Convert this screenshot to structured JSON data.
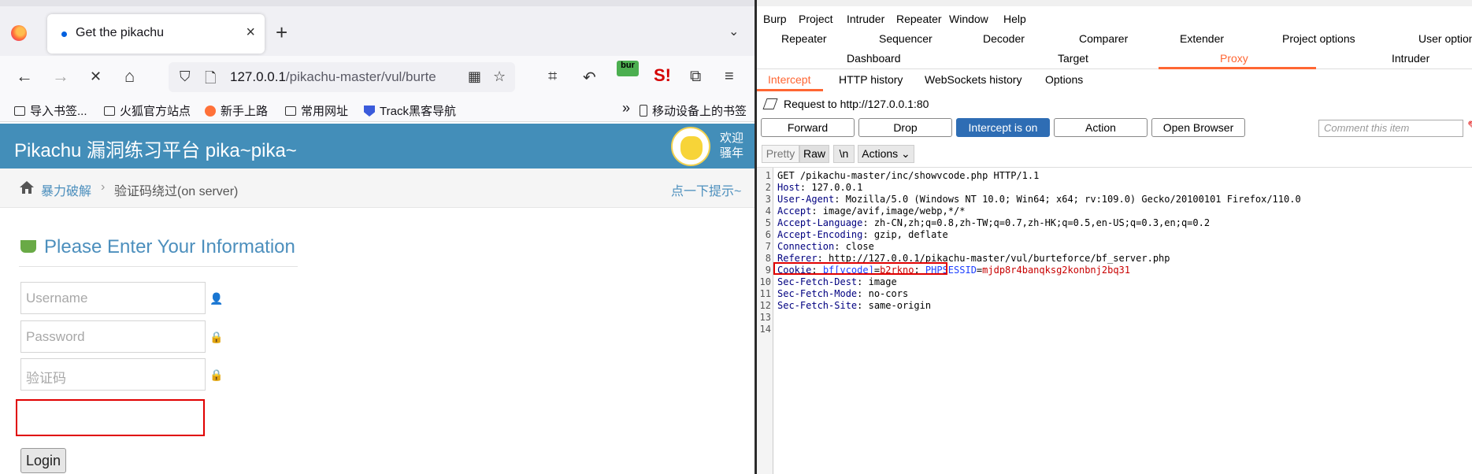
{
  "firefox": {
    "tab": {
      "title": "Get the pikachu",
      "close": "×"
    },
    "newtab": "+",
    "tabs_menu": "⌄",
    "nav": {
      "back": "←",
      "forward": "→",
      "stop": "✕",
      "home": "⌂"
    },
    "url": {
      "host": "127.0.0.1",
      "path": "/pikachu-master/vul/burte"
    },
    "urlbar_icons": {
      "shield": "⛉",
      "page": "🗋",
      "qr": "▦",
      "star": "☆"
    },
    "ext": {
      "crop": "⌗",
      "undo": "↶",
      "bur": "bur",
      "s": "S!",
      "puzzle": "⧉",
      "menu": "≡"
    },
    "bookmarks": [
      "导入书签...",
      "火狐官方站点",
      "新手上路",
      "常用网址",
      "Track黑客导航"
    ],
    "bookmarks_overflow": "»",
    "mobile_bookmarks": "移动设备上的书签",
    "page": {
      "brand": "Pikachu 漏洞练习平台 pika~pika~",
      "welcome": [
        "欢迎",
        "骚年"
      ],
      "breadcrumb": {
        "item1": "暴力破解",
        "sep": "›",
        "item2": "验证码绕过(on server)",
        "hint": "点一下提示~"
      },
      "form_title": "Please Enter Your Information",
      "fields": {
        "username": "Username",
        "password": "Password",
        "captcha": "验证码"
      },
      "field_icons": {
        "username": "👤",
        "password": "🔒",
        "captcha": "🔒"
      },
      "login": "Login"
    }
  },
  "burp": {
    "menu": [
      "Burp",
      "Project",
      "Intruder",
      "Repeater",
      "Window",
      "Help"
    ],
    "tabs_row1": [
      "Repeater",
      "Sequencer",
      "Decoder",
      "Comparer",
      "Extender",
      "Project options",
      "User option"
    ],
    "tabs_row2": [
      "Dashboard",
      "Target",
      "Proxy",
      "Intruder"
    ],
    "proxy_subtabs": [
      "Intercept",
      "HTTP history",
      "WebSockets history",
      "Options"
    ],
    "request_line": "Request to http://127.0.0.1:80",
    "buttons": {
      "forward": "Forward",
      "drop": "Drop",
      "intercept": "Intercept is on",
      "action": "Action",
      "open_browser": "Open Browser"
    },
    "comment_placeholder": "Comment this item",
    "view_tabs": {
      "pretty": "Pretty",
      "raw": "Raw",
      "newline": "\\n",
      "actions": "Actions ⌄"
    },
    "request": {
      "line1": "GET /pikachu-master/inc/showvcode.php HTTP/1.1",
      "headers": [
        {
          "name": "Host",
          "value": "127.0.0.1"
        },
        {
          "name": "User-Agent",
          "value": "Mozilla/5.0 (Windows NT 10.0; Win64; x64; rv:109.0) Gecko/20100101 Firefox/110.0"
        },
        {
          "name": "Accept",
          "value": "image/avif,image/webp,*/*"
        },
        {
          "name": "Accept-Language",
          "value": "zh-CN,zh;q=0.8,zh-TW;q=0.7,zh-HK;q=0.5,en-US;q=0.3,en;q=0.2"
        },
        {
          "name": "Accept-Encoding",
          "value": "gzip, deflate"
        },
        {
          "name": "Connection",
          "value": "close"
        },
        {
          "name": "Referer",
          "value": "http://127.0.0.1/pikachu-master/vul/burteforce/bf_server.php"
        }
      ],
      "cookie": {
        "name": "Cookie",
        "k1": "bf[vcode]",
        "v1": "b2rkno",
        "k2": "PHPSESSID",
        "v2": "mjdp8r4banqksg2konbnj2bq31"
      },
      "headers2": [
        {
          "name": "Sec-Fetch-Dest",
          "value": "image"
        },
        {
          "name": "Sec-Fetch-Mode",
          "value": "no-cors"
        },
        {
          "name": "Sec-Fetch-Site",
          "value": "same-origin"
        }
      ],
      "line_numbers": [
        "1",
        "2",
        "3",
        "4",
        "5",
        "6",
        "7",
        "8",
        "9",
        "10",
        "11",
        "12",
        "13",
        "14"
      ]
    }
  }
}
